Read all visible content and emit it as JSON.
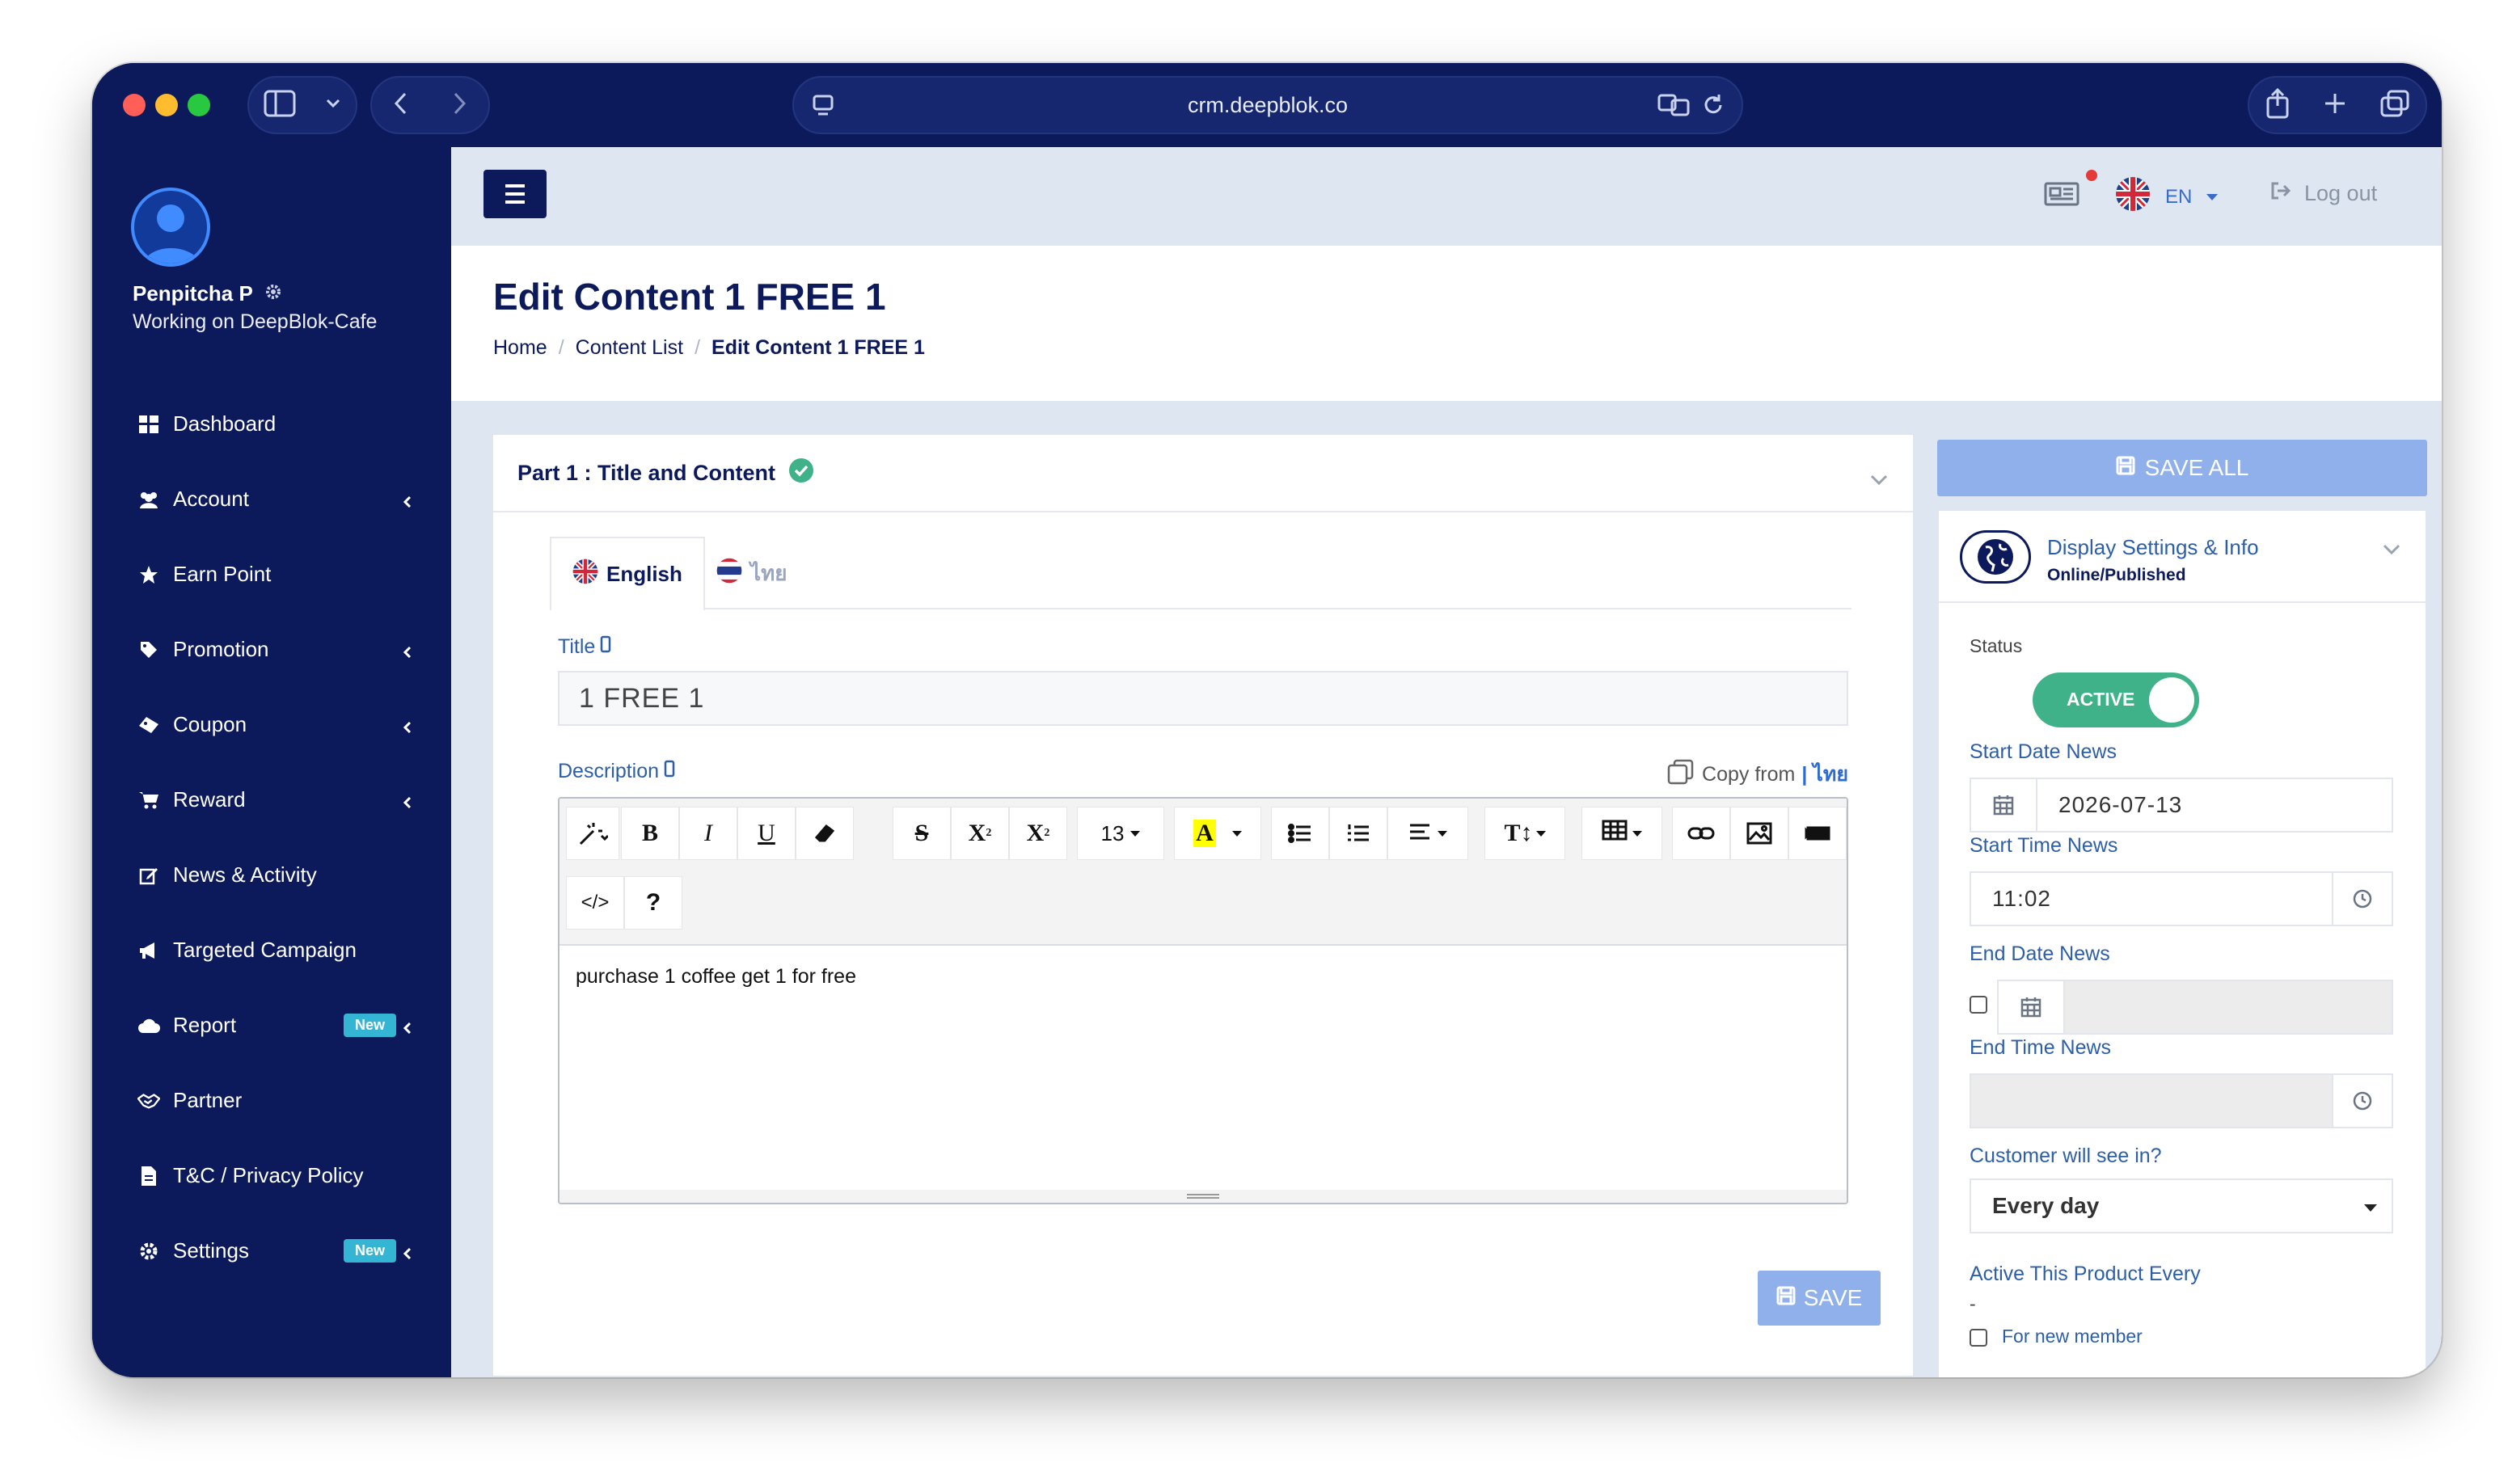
{
  "browser": {
    "url": "crm.deepblok.co"
  },
  "user": {
    "name": "Penpitcha P",
    "workspace": "Working on DeepBlok-Cafe"
  },
  "sidebar": {
    "items": [
      {
        "label": "Dashboard",
        "icon": "dashboard-icon",
        "chevron": false,
        "badge": ""
      },
      {
        "label": "Account",
        "icon": "users-icon",
        "chevron": true,
        "badge": ""
      },
      {
        "label": "Earn Point",
        "icon": "star-icon",
        "chevron": false,
        "badge": ""
      },
      {
        "label": "Promotion",
        "icon": "tag-icon",
        "chevron": true,
        "badge": ""
      },
      {
        "label": "Coupon",
        "icon": "ticket-icon",
        "chevron": true,
        "badge": ""
      },
      {
        "label": "Reward",
        "icon": "cart-icon",
        "chevron": true,
        "badge": ""
      },
      {
        "label": "News & Activity",
        "icon": "edit-icon",
        "chevron": false,
        "badge": ""
      },
      {
        "label": "Targeted Campaign",
        "icon": "megaphone-icon",
        "chevron": false,
        "badge": ""
      },
      {
        "label": "Report",
        "icon": "cloud-icon",
        "chevron": true,
        "badge": "New"
      },
      {
        "label": "Partner",
        "icon": "handshake-icon",
        "chevron": false,
        "badge": ""
      },
      {
        "label": "T&C / Privacy Policy",
        "icon": "document-icon",
        "chevron": false,
        "badge": ""
      },
      {
        "label": "Settings",
        "icon": "gear-icon",
        "chevron": true,
        "badge": "New"
      }
    ]
  },
  "topbar": {
    "language": "EN",
    "logout_label": "Log out"
  },
  "page": {
    "title": "Edit Content 1 FREE 1",
    "breadcrumb": {
      "home": "Home",
      "list": "Content List",
      "current": "Edit Content 1 FREE 1"
    }
  },
  "part1": {
    "heading": "Part 1 : Title and Content",
    "tabs": {
      "english": "English",
      "thai": "ไทย"
    },
    "title_label": "Title",
    "title_value": "1 FREE 1",
    "description_label": "Description",
    "copy_from_label": "Copy from",
    "copy_from_lang": "| ไทย",
    "font_size": "13",
    "description_text": "purchase 1 coffee get 1 for free",
    "save_label": "SAVE"
  },
  "right_panel": {
    "save_all_label": "SAVE ALL",
    "display_title": "Display Settings & Info",
    "display_status": "Online/Published",
    "status_label": "Status",
    "status_toggle": "ACTIVE",
    "start_date_label": "Start Date News",
    "start_date_value": "2026-07-13",
    "start_time_label": "Start Time News",
    "start_time_value": "11:02",
    "end_date_label": "End Date News",
    "end_time_label": "End Time News",
    "customer_see_label": "Customer will see in?",
    "customer_see_value": "Every day",
    "active_every_label": "Active This Product Every",
    "active_every_value": "-",
    "new_member_label": "For new member"
  },
  "colors": {
    "navy": "#0c1a5c",
    "link_blue": "#2d5fa8",
    "save_button": "#8fb0ea",
    "active_green": "#3fb28a",
    "badge_new": "#35b5d4"
  }
}
